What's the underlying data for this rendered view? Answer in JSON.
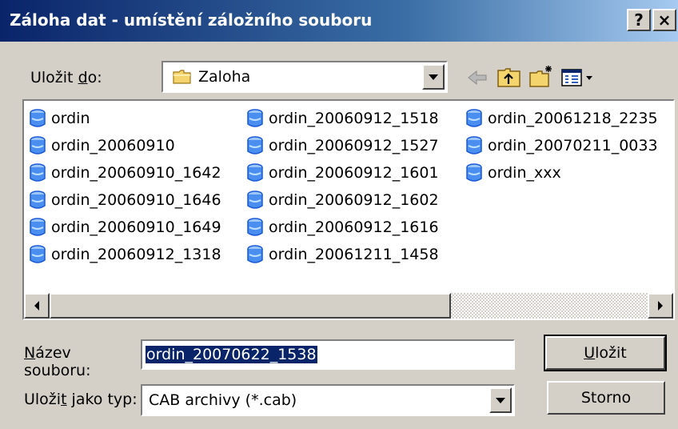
{
  "window": {
    "title": "Záloha dat - umístění záložního souboru",
    "help_button": "?",
    "close_button": "×"
  },
  "save_in": {
    "label_pre": "Uložit ",
    "label_accel": "d",
    "label_post": "o:",
    "value": "Zaloha",
    "folder_icon": "folder-icon"
  },
  "toolbar": {
    "back": "back-arrow-icon",
    "up": "up-folder-icon",
    "new_folder": "new-folder-icon",
    "view": "view-menu-icon"
  },
  "files": {
    "columns": [
      [
        "ordin",
        "ordin_20060910",
        "ordin_20060910_1642",
        "ordin_20060910_1646",
        "ordin_20060910_1649",
        "ordin_20060912_1318"
      ],
      [
        "ordin_20060912_1518",
        "ordin_20060912_1527",
        "ordin_20060912_1601",
        "ordin_20060912_1602",
        "ordin_20060912_1616",
        "ordin_20061211_1458"
      ],
      [
        "ordin_20061218_2235",
        "ordin_20070211_0033",
        "ordin_xxx"
      ]
    ],
    "file_icon": "cab-file-icon"
  },
  "filename": {
    "label_accel": "N",
    "label_rest": "ázev",
    "label_line2": "souboru:",
    "value": "ordin_20070622_1538"
  },
  "filetype": {
    "label_pre": "Uloži",
    "label_accel": "t",
    "label_post": " jako typ:",
    "value": "CAB archivy (*.cab)"
  },
  "buttons": {
    "save_accel": "U",
    "save_rest": "ložit",
    "cancel": "Storno"
  }
}
